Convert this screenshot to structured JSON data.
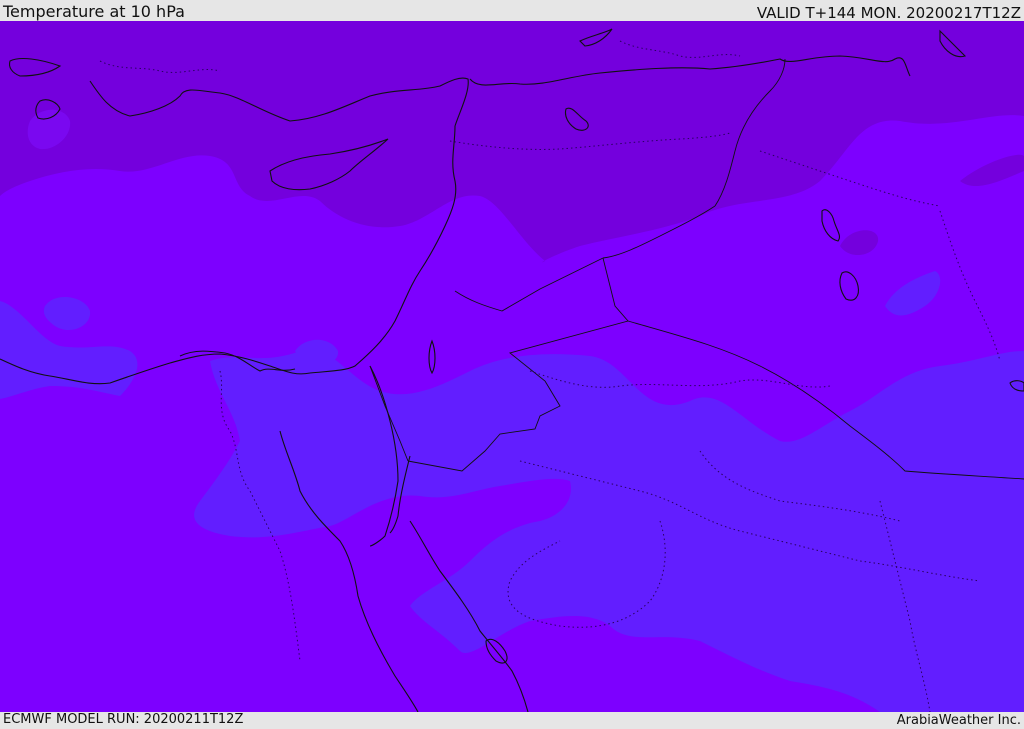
{
  "header": {
    "title": "Temperature at 10 hPa",
    "valid": "VALID T+144 MON. 20200217T12Z"
  },
  "footer": {
    "model_run": "ECMWF MODEL RUN: 20200211T12Z",
    "credit": "ArabiaWeather Inc."
  },
  "map": {
    "parameter": "Temperature",
    "level": "10 hPa",
    "colors": {
      "cold": "#7d00ff",
      "colder": "#7400dd",
      "warmer": "#621eff",
      "land_border": "#111111"
    },
    "icons": {
      "coastline": "coastline-lines",
      "borders": "political-borders"
    }
  }
}
